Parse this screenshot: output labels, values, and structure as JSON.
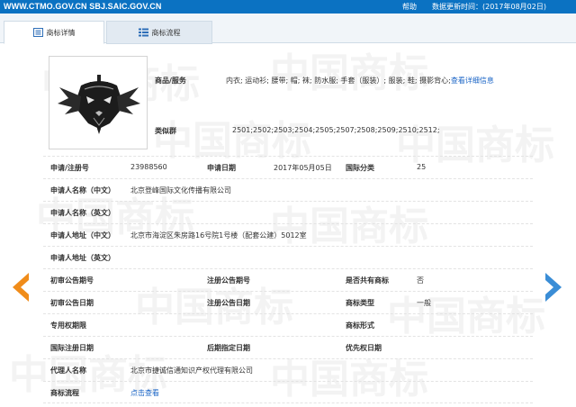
{
  "topbar": {
    "site": "WWW.CTMO.GOV.CN SBJ.SAIC.GOV.CN",
    "help": "帮助",
    "update": "数据更新时间：(2017年08月02日)"
  },
  "tabs": [
    {
      "label": "商标详情"
    },
    {
      "label": "商标流程"
    }
  ],
  "colors": {
    "topbar": "#0b72c2",
    "link": "#1a64c6",
    "arrow_prev": "#f08c1a",
    "arrow_next": "#3a8dd6"
  },
  "icons": {
    "prev": "chevron-left-icon",
    "next": "chevron-right-icon",
    "tab_detail": "list-icon",
    "tab_flow": "grid-icon"
  },
  "watermark": "中国商标",
  "detail": {
    "goods_label": "商品/服务",
    "goods_value": "内衣; 运动衫; 腰带; 帽; 袜; 防水服; 手套（服装）; 服装; 鞋; 摄影背心;",
    "goods_link": "查看详细信息",
    "similar_label": "类似群",
    "similar_value": "2501;2502;2503;2504;2505;2507;2508;2509;2510;2512;"
  },
  "fields": {
    "reg_no_label": "申请/注册号",
    "reg_no": "23988560",
    "app_date_label": "申请日期",
    "app_date": "2017年05月05日",
    "intl_class_label": "国际分类",
    "intl_class": "25",
    "applicant_cn_label": "申请人名称（中文）",
    "applicant_cn": "北京登峰国际文化传播有限公司",
    "applicant_en_label": "申请人名称（英文）",
    "address_cn_label": "申请人地址（中文）",
    "address_cn": "北京市海淀区朱房路16号院1号楼（配套公建）5012室",
    "address_en_label": "申请人地址（英文）",
    "prelim_no_label": "初审公告期号",
    "reg_ann_no_label": "注册公告期号",
    "shared_label": "是否共有商标",
    "shared": "否",
    "prelim_date_label": "初审公告日期",
    "reg_ann_date_label": "注册公告日期",
    "tm_type_label": "商标类型",
    "tm_type": "一般",
    "exclusive_label": "专用权期限",
    "tm_form_label": "商标形式",
    "intl_reg_date_label": "国际注册日期",
    "later_date_label": "后期指定日期",
    "priority_date_label": "优先权日期",
    "agent_label": "代理人名称",
    "agent": "北京市捷诚信通知识产权代理有限公司",
    "flow_label": "商标流程",
    "flow_link": "点击查看"
  }
}
